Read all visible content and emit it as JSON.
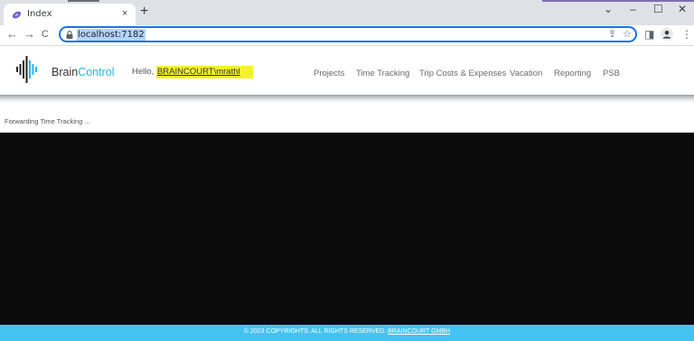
{
  "browser": {
    "tab_title": "Index",
    "tab_close": "×",
    "new_tab": "+",
    "url": "localhost:7182",
    "window_controls": {
      "chevron": "⌄",
      "minimize": "–",
      "maximize": "☐",
      "close": "✕"
    },
    "nav_icons": {
      "back": "←",
      "forward": "→",
      "reload": "C"
    },
    "omni_icons": {
      "share": "⇪",
      "bookmark": "☆"
    },
    "toolbar_icons": {
      "side_panel": "◨",
      "menu": "⋮"
    }
  },
  "header": {
    "brand_part1": "Brain",
    "brand_part2": "Control",
    "greeting": "Hello, ",
    "username": "BRAINCOURT\\mrathl",
    "nav": [
      "Projects",
      "Time Tracking",
      "Trip Costs & Expenses",
      "Vacation",
      "Reporting",
      "PSB"
    ]
  },
  "main": {
    "status": "Forwarding Time Tracking ..."
  },
  "footer": {
    "text": "© 2023 COPYRIGHTS. ALL RIGHTS RESERVED. ",
    "link": "BRAINCOURT GMBH"
  },
  "colors": {
    "brand_accent": "#2bb3e8",
    "footer_bg": "#44c3f2",
    "highlight": "#f6f22a",
    "content_bg": "#0b0b0b",
    "url_selection": "#b3d3fb",
    "omnibox_focus": "#1a73e8"
  }
}
